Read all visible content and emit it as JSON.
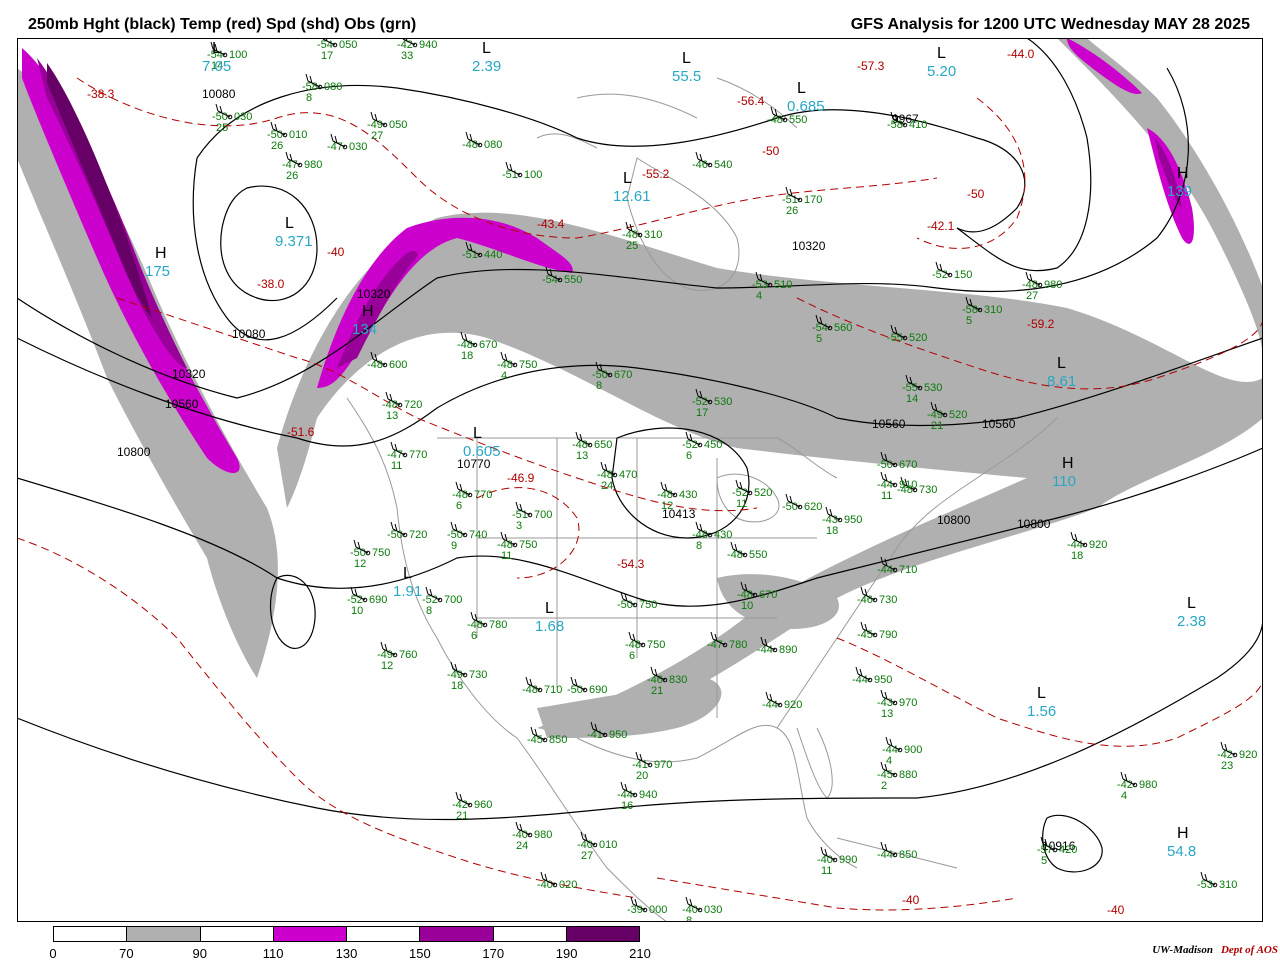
{
  "title_left": "250mb Hght (black) Temp (red) Spd (shd) Obs (grn)",
  "title_right": "GFS Analysis for 1200 UTC Wednesday  MAY 28 2025",
  "credit": {
    "org": "UW-Madison",
    "dept": "Dept of AOS"
  },
  "legend": {
    "ticks": [
      "0",
      "70",
      "90",
      "110",
      "130",
      "150",
      "170",
      "190",
      "210"
    ],
    "colors": [
      "#ffffff",
      "#b0b0b0",
      "#ffffff",
      "#cc00cc",
      "#ffffff",
      "#990099",
      "#ffffff",
      "#660066"
    ]
  },
  "colors": {
    "height": "#000000",
    "temp": "#b00000",
    "obs": "#0a7a0a",
    "centers": "#2aa7c4",
    "jet_gray": "#b0b0b0",
    "jet_magenta": "#cc00cc",
    "jet_purple": "#990099",
    "jet_dark": "#660066"
  },
  "height_labels": [
    "10080",
    "10080",
    "10320",
    "10560",
    "10800",
    "10320",
    "10560",
    "10800",
    "10770",
    "10413",
    "9967",
    "10320",
    "10560",
    "10800",
    "10916"
  ],
  "temp_labels": [
    "-38.3",
    "-40",
    "-38.0",
    "-51.6",
    "-46.9",
    "-54.3",
    "-43.4",
    "-55.2",
    "-56.4",
    "-50",
    "-57.3",
    "-44.0",
    "-50",
    "-42.1",
    "-59.2",
    "-40",
    "-40"
  ],
  "centers": [
    {
      "letter": "L",
      "value": "9.371",
      "kind": "low"
    },
    {
      "letter": "H",
      "value": "175",
      "kind": "high"
    },
    {
      "letter": "H",
      "value": "134",
      "kind": "high"
    },
    {
      "letter": "L",
      "value": "0.605",
      "kind": "low"
    },
    {
      "letter": "L",
      "value": "1.91",
      "kind": "low"
    },
    {
      "letter": "L",
      "value": "1.68",
      "kind": "low"
    },
    {
      "letter": "L",
      "value": "12.61",
      "kind": "low"
    },
    {
      "letter": "L",
      "value": "55.5",
      "kind": "low"
    },
    {
      "letter": "L",
      "value": "0.685",
      "kind": "low"
    },
    {
      "letter": "L",
      "value": "5.20",
      "kind": "low"
    },
    {
      "letter": "H",
      "value": "139",
      "kind": "high"
    },
    {
      "letter": "L",
      "value": "8.61",
      "kind": "low"
    },
    {
      "letter": "H",
      "value": "110",
      "kind": "high"
    },
    {
      "letter": "L",
      "value": "2.38",
      "kind": "low"
    },
    {
      "letter": "L",
      "value": "1.56",
      "kind": "low"
    },
    {
      "letter": "H",
      "value": "54.8",
      "kind": "high"
    },
    {
      "letter": "L",
      "value": "2.39",
      "kind": "low"
    },
    {
      "letter": "L",
      "value": "7.05",
      "kind": "low"
    }
  ],
  "observations": [
    {
      "t": "-54",
      "h": "100",
      "s": "14"
    },
    {
      "t": "-58",
      "h": "080",
      "s": "8"
    },
    {
      "t": "-50",
      "h": "030",
      "s": "25"
    },
    {
      "t": "-50",
      "h": "010",
      "s": "26"
    },
    {
      "t": "-47",
      "h": "980",
      "s": "26"
    },
    {
      "t": "-47",
      "h": "030",
      "s": ""
    },
    {
      "t": "-49",
      "h": "050",
      "s": "27"
    },
    {
      "t": "-54",
      "h": "050",
      "s": "17"
    },
    {
      "t": "-42",
      "h": "940",
      "s": "33"
    },
    {
      "t": "-48",
      "h": "080",
      "s": ""
    },
    {
      "t": "-51",
      "h": "100",
      "s": ""
    },
    {
      "t": "-48",
      "h": "310",
      "s": "25"
    },
    {
      "t": "-53",
      "h": "510",
      "s": "4"
    },
    {
      "t": "-54",
      "h": "560",
      "s": "5"
    },
    {
      "t": "-55",
      "h": "520",
      "s": ""
    },
    {
      "t": "-55",
      "h": "530",
      "s": "14"
    },
    {
      "t": "-49",
      "h": "520",
      "s": "21"
    },
    {
      "t": "-50",
      "h": "670",
      "s": ""
    },
    {
      "t": "-48",
      "h": "730",
      "s": ""
    },
    {
      "t": "-52",
      "h": "530",
      "s": "17"
    },
    {
      "t": "-52",
      "h": "450",
      "s": "6"
    },
    {
      "t": "-48",
      "h": "470",
      "s": "24"
    },
    {
      "t": "-48",
      "h": "430",
      "s": "12"
    },
    {
      "t": "-52",
      "h": "520",
      "s": "11"
    },
    {
      "t": "-50",
      "h": "620",
      "s": ""
    },
    {
      "t": "-48",
      "h": "430",
      "s": "8"
    },
    {
      "t": "-48",
      "h": "550",
      "s": ""
    },
    {
      "t": "-48",
      "h": "670",
      "s": "10"
    },
    {
      "t": "-48",
      "h": "650",
      "s": "13"
    },
    {
      "t": "-50",
      "h": "670",
      "s": "8"
    },
    {
      "t": "-48",
      "h": "750",
      "s": "4"
    },
    {
      "t": "-48",
      "h": "670",
      "s": "18"
    },
    {
      "t": "-48",
      "h": "600",
      "s": ""
    },
    {
      "t": "-48",
      "h": "720",
      "s": "13"
    },
    {
      "t": "-47",
      "h": "770",
      "s": "11"
    },
    {
      "t": "-48",
      "h": "770",
      "s": "6"
    },
    {
      "t": "-51",
      "h": "700",
      "s": "3"
    },
    {
      "t": "-50",
      "h": "720",
      "s": ""
    },
    {
      "t": "-50",
      "h": "740",
      "s": "9"
    },
    {
      "t": "-50",
      "h": "750",
      "s": "12"
    },
    {
      "t": "-48",
      "h": "750",
      "s": "11"
    },
    {
      "t": "-52",
      "h": "690",
      "s": "10"
    },
    {
      "t": "-52",
      "h": "700",
      "s": "8"
    },
    {
      "t": "-48",
      "h": "780",
      "s": "6"
    },
    {
      "t": "-49",
      "h": "760",
      "s": "12"
    },
    {
      "t": "-49",
      "h": "730",
      "s": "18"
    },
    {
      "t": "-48",
      "h": "710",
      "s": ""
    },
    {
      "t": "-50",
      "h": "690",
      "s": ""
    },
    {
      "t": "-50",
      "h": "750",
      "s": ""
    },
    {
      "t": "-48",
      "h": "750",
      "s": "6"
    },
    {
      "t": "-47",
      "h": "780",
      "s": ""
    },
    {
      "t": "-46",
      "h": "830",
      "s": "21"
    },
    {
      "t": "-45",
      "h": "850",
      "s": ""
    },
    {
      "t": "-41",
      "h": "950",
      "s": ""
    },
    {
      "t": "-41",
      "h": "970",
      "s": "20"
    },
    {
      "t": "-44",
      "h": "940",
      "s": "16"
    },
    {
      "t": "-42",
      "h": "960",
      "s": "21"
    },
    {
      "t": "-40",
      "h": "980",
      "s": "24"
    },
    {
      "t": "-40",
      "h": "010",
      "s": "27"
    },
    {
      "t": "-40",
      "h": "020",
      "s": ""
    },
    {
      "t": "-39",
      "h": "000",
      "s": ""
    },
    {
      "t": "-40",
      "h": "030",
      "s": "8"
    },
    {
      "t": "-40",
      "h": "990",
      "s": "11"
    },
    {
      "t": "-44",
      "h": "850",
      "s": ""
    },
    {
      "t": "-44",
      "h": "890",
      "s": ""
    },
    {
      "t": "-44",
      "h": "920",
      "s": ""
    },
    {
      "t": "-44",
      "h": "950",
      "s": ""
    },
    {
      "t": "-43",
      "h": "970",
      "s": "13"
    },
    {
      "t": "-44",
      "h": "900",
      "s": "4"
    },
    {
      "t": "-45",
      "h": "880",
      "s": "2"
    },
    {
      "t": "-45",
      "h": "790",
      "s": ""
    },
    {
      "t": "-46",
      "h": "730",
      "s": ""
    },
    {
      "t": "-44",
      "h": "710",
      "s": ""
    },
    {
      "t": "-44",
      "h": "910",
      "s": "11"
    },
    {
      "t": "-43",
      "h": "950",
      "s": "18"
    },
    {
      "t": "-44",
      "h": "920",
      "s": "18"
    },
    {
      "t": "-42",
      "h": "920",
      "s": "23"
    },
    {
      "t": "-42",
      "h": "980",
      "s": "4"
    },
    {
      "t": "-57",
      "h": "420",
      "s": "5"
    },
    {
      "t": "-53",
      "h": "310",
      "s": ""
    },
    {
      "t": "-58",
      "h": "310",
      "s": "5"
    },
    {
      "t": "-48",
      "h": "980",
      "s": "27"
    },
    {
      "t": "-52",
      "h": "150",
      "s": ""
    },
    {
      "t": "-58",
      "h": "410",
      "s": ""
    },
    {
      "t": "-51",
      "h": "170",
      "s": "26"
    },
    {
      "t": "-48",
      "h": "550",
      "s": ""
    },
    {
      "t": "-46",
      "h": "540",
      "s": ""
    },
    {
      "t": "-51",
      "h": "440",
      "s": ""
    },
    {
      "t": "-54",
      "h": "550",
      "s": ""
    }
  ]
}
